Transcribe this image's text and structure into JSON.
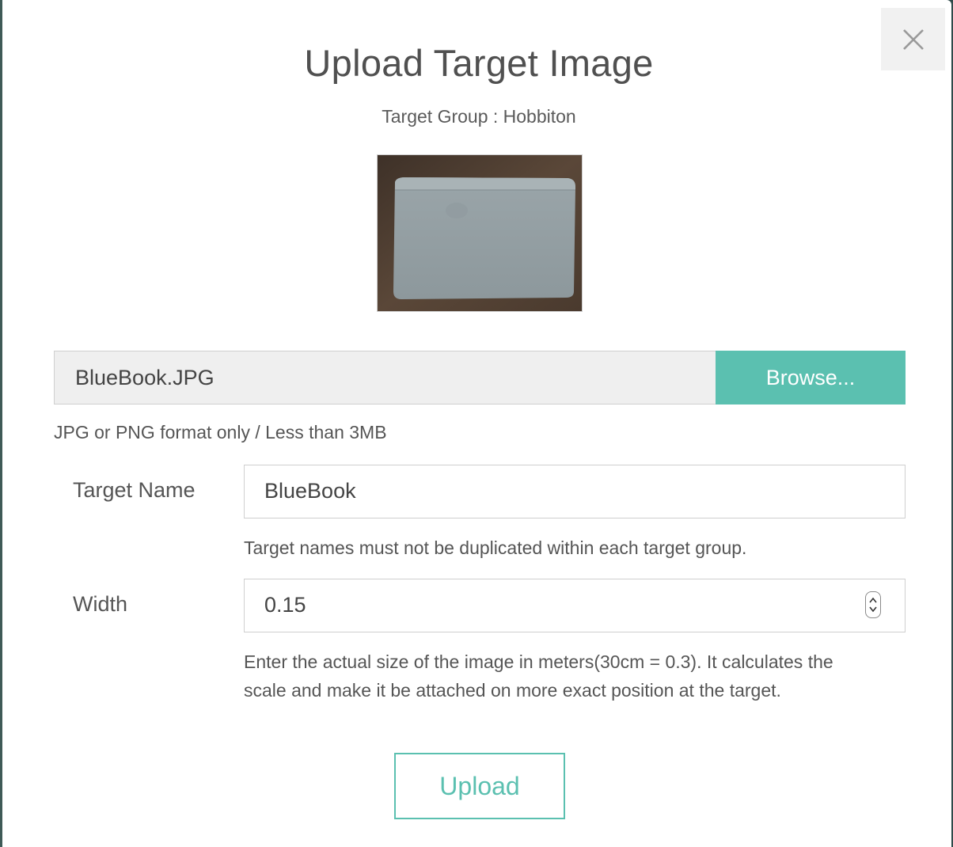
{
  "dialog": {
    "title": "Upload Target Image",
    "subtitle": "Target Group : Hobbiton",
    "close_icon": "close-icon"
  },
  "file": {
    "name": "BlueBook.JPG",
    "browse_label": "Browse...",
    "format_hint": "JPG or PNG format only / Less than 3MB"
  },
  "target_name": {
    "label": "Target Name",
    "value": "BlueBook",
    "help": "Target names must not be duplicated within each target group."
  },
  "width": {
    "label": "Width",
    "value": "0.15",
    "help_line1": "Enter the actual size of the image in meters(30cm = 0.3). It calculates the",
    "help_line2": "scale and make it be attached on more exact position at the target."
  },
  "upload_label": "Upload",
  "colors": {
    "accent": "#5bc0b0",
    "text": "#555555"
  }
}
